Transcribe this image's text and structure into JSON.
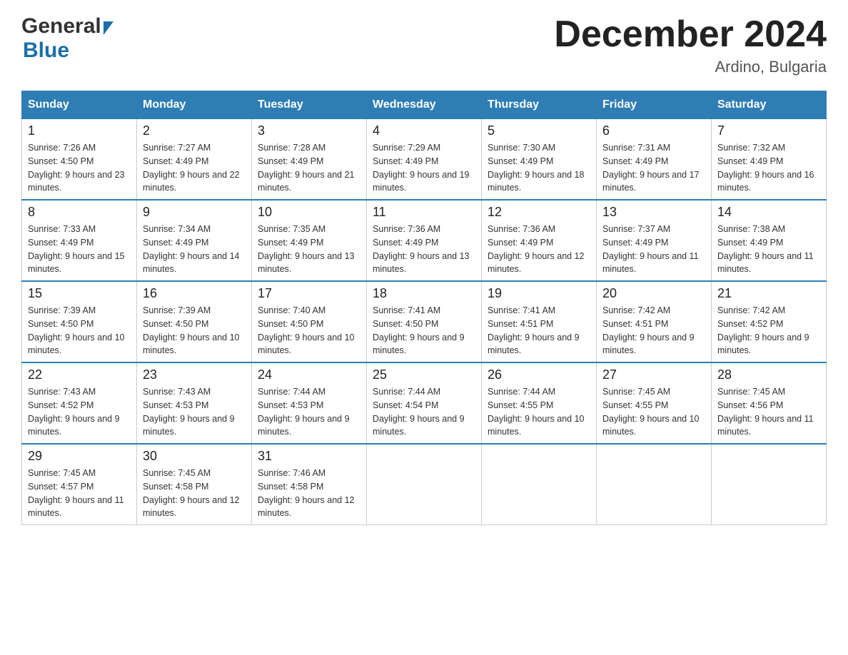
{
  "header": {
    "logo_general": "General",
    "logo_blue": "Blue",
    "title": "December 2024",
    "subtitle": "Ardino, Bulgaria"
  },
  "days_of_week": [
    "Sunday",
    "Monday",
    "Tuesday",
    "Wednesday",
    "Thursday",
    "Friday",
    "Saturday"
  ],
  "weeks": [
    [
      {
        "num": "1",
        "sunrise": "7:26 AM",
        "sunset": "4:50 PM",
        "daylight": "9 hours and 23 minutes."
      },
      {
        "num": "2",
        "sunrise": "7:27 AM",
        "sunset": "4:49 PM",
        "daylight": "9 hours and 22 minutes."
      },
      {
        "num": "3",
        "sunrise": "7:28 AM",
        "sunset": "4:49 PM",
        "daylight": "9 hours and 21 minutes."
      },
      {
        "num": "4",
        "sunrise": "7:29 AM",
        "sunset": "4:49 PM",
        "daylight": "9 hours and 19 minutes."
      },
      {
        "num": "5",
        "sunrise": "7:30 AM",
        "sunset": "4:49 PM",
        "daylight": "9 hours and 18 minutes."
      },
      {
        "num": "6",
        "sunrise": "7:31 AM",
        "sunset": "4:49 PM",
        "daylight": "9 hours and 17 minutes."
      },
      {
        "num": "7",
        "sunrise": "7:32 AM",
        "sunset": "4:49 PM",
        "daylight": "9 hours and 16 minutes."
      }
    ],
    [
      {
        "num": "8",
        "sunrise": "7:33 AM",
        "sunset": "4:49 PM",
        "daylight": "9 hours and 15 minutes."
      },
      {
        "num": "9",
        "sunrise": "7:34 AM",
        "sunset": "4:49 PM",
        "daylight": "9 hours and 14 minutes."
      },
      {
        "num": "10",
        "sunrise": "7:35 AM",
        "sunset": "4:49 PM",
        "daylight": "9 hours and 13 minutes."
      },
      {
        "num": "11",
        "sunrise": "7:36 AM",
        "sunset": "4:49 PM",
        "daylight": "9 hours and 13 minutes."
      },
      {
        "num": "12",
        "sunrise": "7:36 AM",
        "sunset": "4:49 PM",
        "daylight": "9 hours and 12 minutes."
      },
      {
        "num": "13",
        "sunrise": "7:37 AM",
        "sunset": "4:49 PM",
        "daylight": "9 hours and 11 minutes."
      },
      {
        "num": "14",
        "sunrise": "7:38 AM",
        "sunset": "4:49 PM",
        "daylight": "9 hours and 11 minutes."
      }
    ],
    [
      {
        "num": "15",
        "sunrise": "7:39 AM",
        "sunset": "4:50 PM",
        "daylight": "9 hours and 10 minutes."
      },
      {
        "num": "16",
        "sunrise": "7:39 AM",
        "sunset": "4:50 PM",
        "daylight": "9 hours and 10 minutes."
      },
      {
        "num": "17",
        "sunrise": "7:40 AM",
        "sunset": "4:50 PM",
        "daylight": "9 hours and 10 minutes."
      },
      {
        "num": "18",
        "sunrise": "7:41 AM",
        "sunset": "4:50 PM",
        "daylight": "9 hours and 9 minutes."
      },
      {
        "num": "19",
        "sunrise": "7:41 AM",
        "sunset": "4:51 PM",
        "daylight": "9 hours and 9 minutes."
      },
      {
        "num": "20",
        "sunrise": "7:42 AM",
        "sunset": "4:51 PM",
        "daylight": "9 hours and 9 minutes."
      },
      {
        "num": "21",
        "sunrise": "7:42 AM",
        "sunset": "4:52 PM",
        "daylight": "9 hours and 9 minutes."
      }
    ],
    [
      {
        "num": "22",
        "sunrise": "7:43 AM",
        "sunset": "4:52 PM",
        "daylight": "9 hours and 9 minutes."
      },
      {
        "num": "23",
        "sunrise": "7:43 AM",
        "sunset": "4:53 PM",
        "daylight": "9 hours and 9 minutes."
      },
      {
        "num": "24",
        "sunrise": "7:44 AM",
        "sunset": "4:53 PM",
        "daylight": "9 hours and 9 minutes."
      },
      {
        "num": "25",
        "sunrise": "7:44 AM",
        "sunset": "4:54 PM",
        "daylight": "9 hours and 9 minutes."
      },
      {
        "num": "26",
        "sunrise": "7:44 AM",
        "sunset": "4:55 PM",
        "daylight": "9 hours and 10 minutes."
      },
      {
        "num": "27",
        "sunrise": "7:45 AM",
        "sunset": "4:55 PM",
        "daylight": "9 hours and 10 minutes."
      },
      {
        "num": "28",
        "sunrise": "7:45 AM",
        "sunset": "4:56 PM",
        "daylight": "9 hours and 11 minutes."
      }
    ],
    [
      {
        "num": "29",
        "sunrise": "7:45 AM",
        "sunset": "4:57 PM",
        "daylight": "9 hours and 11 minutes."
      },
      {
        "num": "30",
        "sunrise": "7:45 AM",
        "sunset": "4:58 PM",
        "daylight": "9 hours and 12 minutes."
      },
      {
        "num": "31",
        "sunrise": "7:46 AM",
        "sunset": "4:58 PM",
        "daylight": "9 hours and 12 minutes."
      },
      null,
      null,
      null,
      null
    ]
  ]
}
